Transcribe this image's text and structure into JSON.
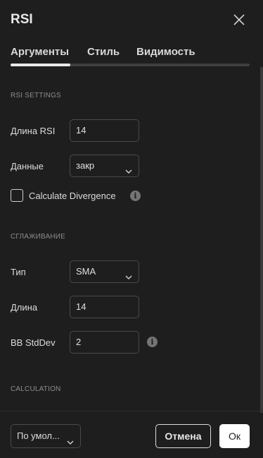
{
  "dialog": {
    "title": "RSI",
    "tabs": [
      {
        "label": "Аргументы",
        "active": true
      },
      {
        "label": "Стиль",
        "active": false
      },
      {
        "label": "Видимость",
        "active": false
      }
    ]
  },
  "rsi_settings": {
    "heading": "RSI SETTINGS",
    "length_label": "Длина RSI",
    "length_value": "14",
    "source_label": "Данные",
    "source_value": "закр",
    "divergence_label": "Calculate Divergence",
    "divergence_checked": false
  },
  "smoothing": {
    "heading": "СГЛАЖИВАНИЕ",
    "type_label": "Тип",
    "type_value": "SMA",
    "length_label": "Длина",
    "length_value": "14",
    "stddev_label": "BB StdDev",
    "stddev_value": "2"
  },
  "calculation": {
    "heading": "CALCULATION"
  },
  "footer": {
    "preset_label": "По умол...",
    "cancel_label": "Отмена",
    "ok_label": "Ок"
  },
  "icons": {
    "close": "close-icon",
    "info": "info-icon",
    "chevron": "chevron-down-icon"
  }
}
